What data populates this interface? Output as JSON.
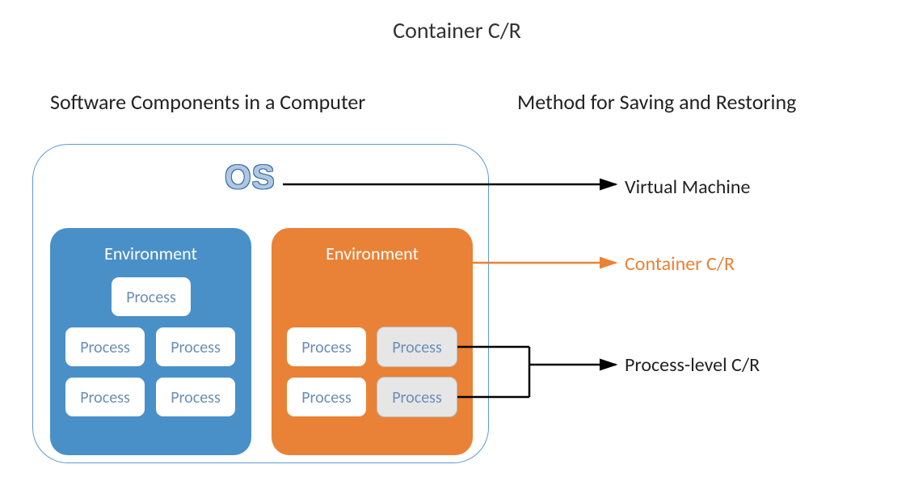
{
  "title": "Container C/R",
  "subtitle_left": "Software Components in a Computer",
  "subtitle_right": "Method for Saving and Restoring",
  "os_label": "OS",
  "env_blue": {
    "title": "Environment",
    "processes": [
      "Process",
      "Process",
      "Process",
      "Process",
      "Process"
    ]
  },
  "env_orange": {
    "title": "Environment",
    "processes_white": [
      "Process",
      "Process"
    ],
    "processes_grey": [
      "Process",
      "Process"
    ]
  },
  "methods": {
    "vm": "Virtual Machine",
    "container": "Container C/R",
    "process": "Process-level C/R"
  },
  "colors": {
    "blue": "#4a90c8",
    "orange": "#e98236",
    "grey": "#e6e6e6",
    "border_box": "#5b9bd5"
  }
}
